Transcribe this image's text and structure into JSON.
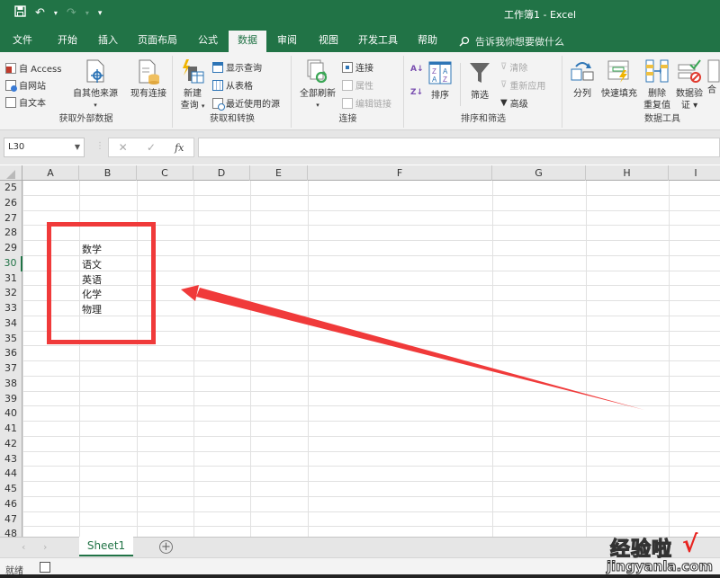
{
  "titlebar": {
    "title": "工作簿1 - Excel",
    "qat": {
      "save_icon": "💾",
      "undo_icon": "↶",
      "redo_icon": "↷",
      "customize_icon": "▾"
    }
  },
  "tabs": [
    {
      "label": "文件",
      "active": false
    },
    {
      "label": "开始",
      "active": false
    },
    {
      "label": "插入",
      "active": false
    },
    {
      "label": "页面布局",
      "active": false
    },
    {
      "label": "公式",
      "active": false
    },
    {
      "label": "数据",
      "active": true
    },
    {
      "label": "审阅",
      "active": false
    },
    {
      "label": "视图",
      "active": false
    },
    {
      "label": "开发工具",
      "active": false
    },
    {
      "label": "帮助",
      "active": false
    }
  ],
  "tell_me": {
    "placeholder": "告诉我你想要做什么"
  },
  "ribbon": {
    "get_external": {
      "label": "获取外部数据",
      "from_access": "自 Access",
      "from_web": "自网站",
      "from_text": "自文本",
      "from_other": "自其他来源",
      "existing_conn": "现有连接"
    },
    "get_transform": {
      "label": "获取和转换",
      "new_query_1": "新建",
      "new_query_2": "查询",
      "show_queries": "显示查询",
      "from_table": "从表格",
      "recent_sources": "最近使用的源"
    },
    "connections": {
      "label": "连接",
      "refresh_all": "全部刷新",
      "connections": "连接",
      "properties": "属性",
      "edit_links": "编辑链接"
    },
    "sort_filter": {
      "label": "排序和筛选",
      "sort": "排序",
      "filter": "筛选",
      "clear": "清除",
      "reapply": "重新应用",
      "advanced": "高级"
    },
    "data_tools": {
      "label": "数据工具",
      "text_to_columns": "分列",
      "flash_fill": "快速填充",
      "remove_dup_1": "删除",
      "remove_dup_2": "重复值",
      "validation_1": "数据验",
      "validation_2": "证 ▾",
      "consolidate": "合"
    }
  },
  "formula_bar": {
    "name_box": "L30",
    "cancel_icon": "✕",
    "enter_icon": "✓",
    "fx_label": "fx",
    "formula": ""
  },
  "columns": [
    "A",
    "B",
    "C",
    "D",
    "E",
    "F",
    "G",
    "H",
    "I"
  ],
  "rows": [
    25,
    26,
    27,
    28,
    29,
    30,
    31,
    32,
    33,
    34,
    35,
    36,
    37,
    38,
    39,
    40,
    41,
    42,
    43,
    44,
    45,
    46,
    47,
    48
  ],
  "selected_row": 30,
  "cells": [
    {
      "ref": "B29",
      "value": "数学"
    },
    {
      "ref": "B30",
      "value": "语文"
    },
    {
      "ref": "B31",
      "value": "英语"
    },
    {
      "ref": "B32",
      "value": "化学"
    },
    {
      "ref": "B33",
      "value": "物理"
    }
  ],
  "annotation": {
    "color": "#f03a3a"
  },
  "sheets": [
    {
      "name": "Sheet1",
      "active": true
    }
  ],
  "add_sheet_icon": "+",
  "nav": {
    "prev": "‹",
    "next": "›"
  },
  "status": {
    "text": "就绪"
  },
  "watermark": {
    "line1": "经验啦",
    "check": "√",
    "line2": "jingyanla.com"
  },
  "colors": {
    "brand": "#217346",
    "annotation": "#f03a3a"
  }
}
